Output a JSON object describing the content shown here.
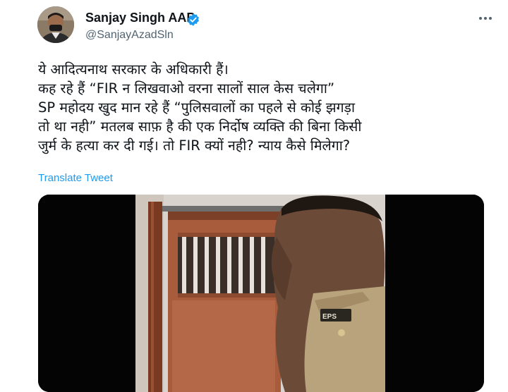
{
  "author": {
    "name": "Sanjay Singh AAP",
    "handle": "@SanjayAzadSln"
  },
  "tweet": {
    "lines": [
      "ये आदित्यनाथ सरकार के अधिकारी हैं।",
      "कह रहे हैं “FIR न लिखवाओ वरना सालों साल केस चलेगा”",
      "SP महोदय खुद मान रहे हैं “पुलिसवालों का पहले से कोई झगड़ा",
      "तो था नही” मतलब साफ़ है की एक निर्दोष व्यक्ति की बिना किसी",
      "जुर्म के हत्या कर दी गई। तो FIR क्यों नही? न्याय कैसे मिलेगा?"
    ],
    "translate_label": "Translate Tweet"
  },
  "media": {
    "badge_text": "EPS"
  },
  "colors": {
    "link": "#1d9bf0",
    "verified": "#1d9bf0",
    "muted": "#536471"
  }
}
